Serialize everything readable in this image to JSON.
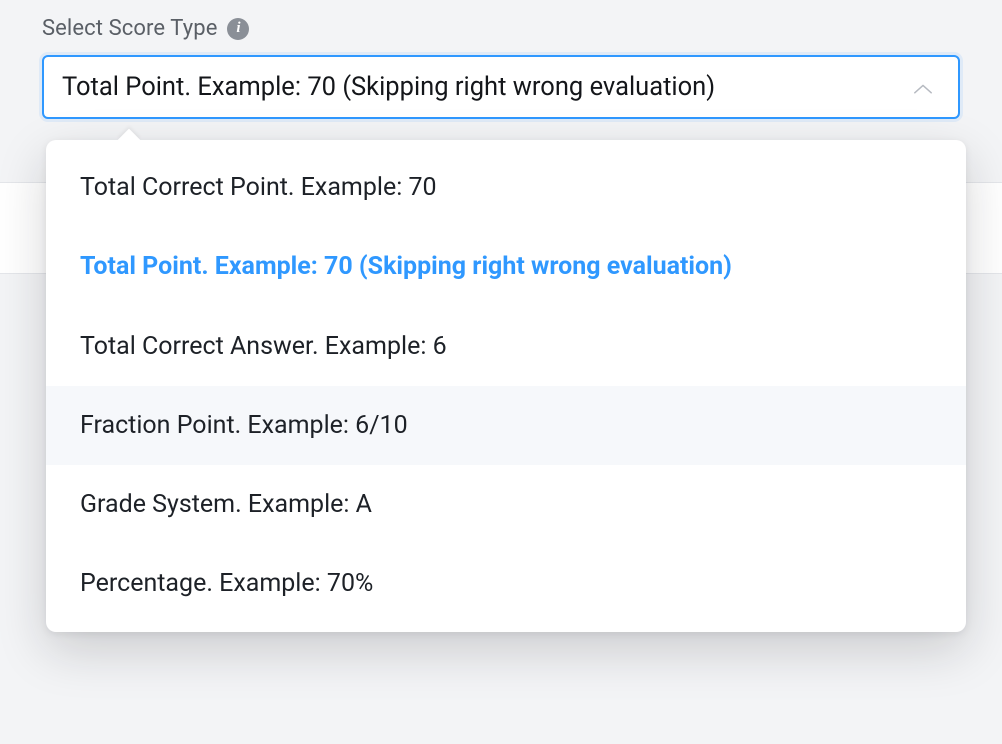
{
  "field": {
    "label": "Select Score Type",
    "info_icon": "info-icon"
  },
  "select": {
    "value": "Total Point. Example: 70 (Skipping right wrong evaluation)",
    "options": [
      {
        "label": "Total Correct Point. Example: 70",
        "selected": false,
        "hovered": false
      },
      {
        "label": "Total Point. Example: 70 (Skipping right wrong evaluation)",
        "selected": true,
        "hovered": false
      },
      {
        "label": "Total Correct Answer. Example: 6",
        "selected": false,
        "hovered": false
      },
      {
        "label": "Fraction Point. Example: 6/10",
        "selected": false,
        "hovered": true
      },
      {
        "label": "Grade System. Example: A",
        "selected": false,
        "hovered": false
      },
      {
        "label": "Percentage. Example: 70%",
        "selected": false,
        "hovered": false
      }
    ]
  }
}
